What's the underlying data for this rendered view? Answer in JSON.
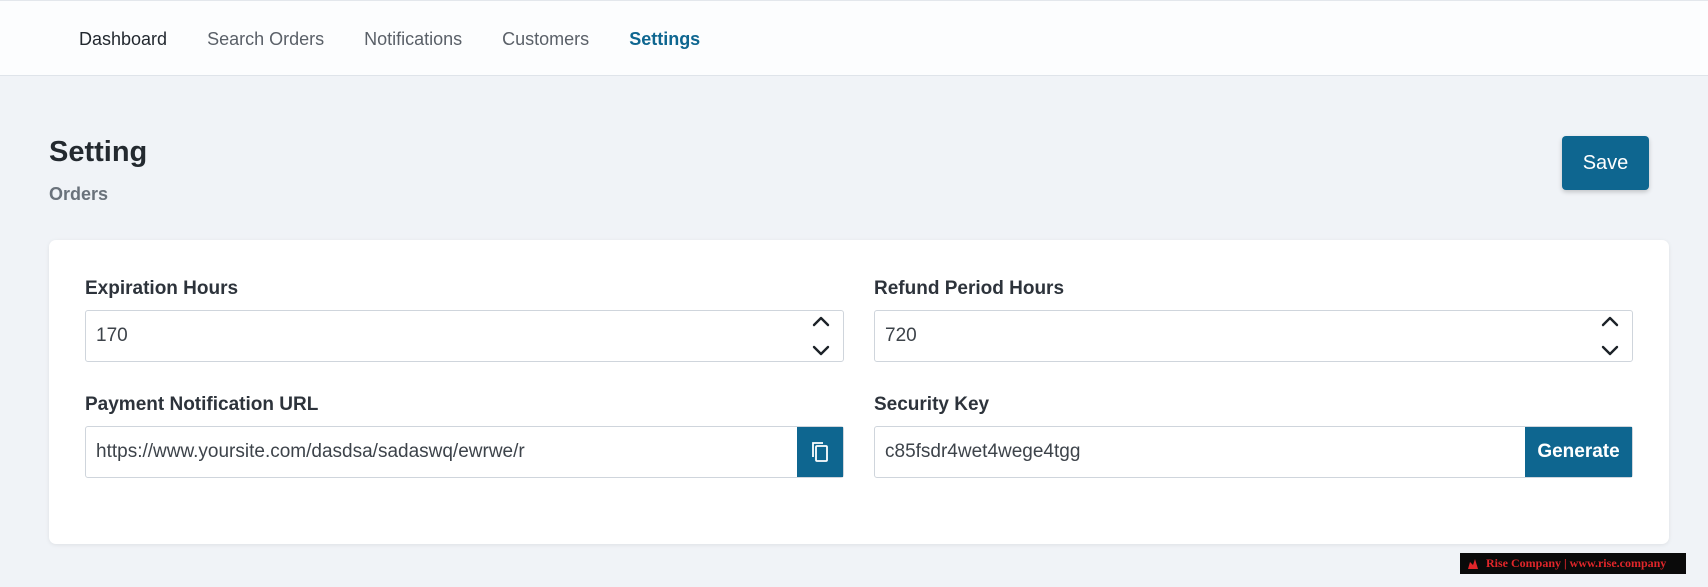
{
  "nav": {
    "items": [
      {
        "label": "Dashboard"
      },
      {
        "label": "Search Orders"
      },
      {
        "label": "Notifications"
      },
      {
        "label": "Customers"
      },
      {
        "label": "Settings"
      }
    ],
    "active": "Settings"
  },
  "header": {
    "title": "Setting",
    "subtitle": "Orders",
    "save_label": "Save"
  },
  "form": {
    "expiration": {
      "label": "Expiration Hours",
      "value": "170"
    },
    "refund": {
      "label": "Refund Period Hours",
      "value": "720"
    },
    "payment_url": {
      "label": "Payment Notification URL",
      "value": "https://www.yoursite.com/dasdsa/sadaswq/ewrwe/r",
      "copy_icon": "copy-icon"
    },
    "security_key": {
      "label": "Security Key",
      "value": "c85fsdr4wet4wege4tgg",
      "generate_label": "Generate"
    }
  },
  "watermark": {
    "text": "Rise Company | www.rise.company"
  },
  "colors": {
    "accent": "#0e6690",
    "background": "#f0f3f7",
    "card": "#ffffff"
  }
}
